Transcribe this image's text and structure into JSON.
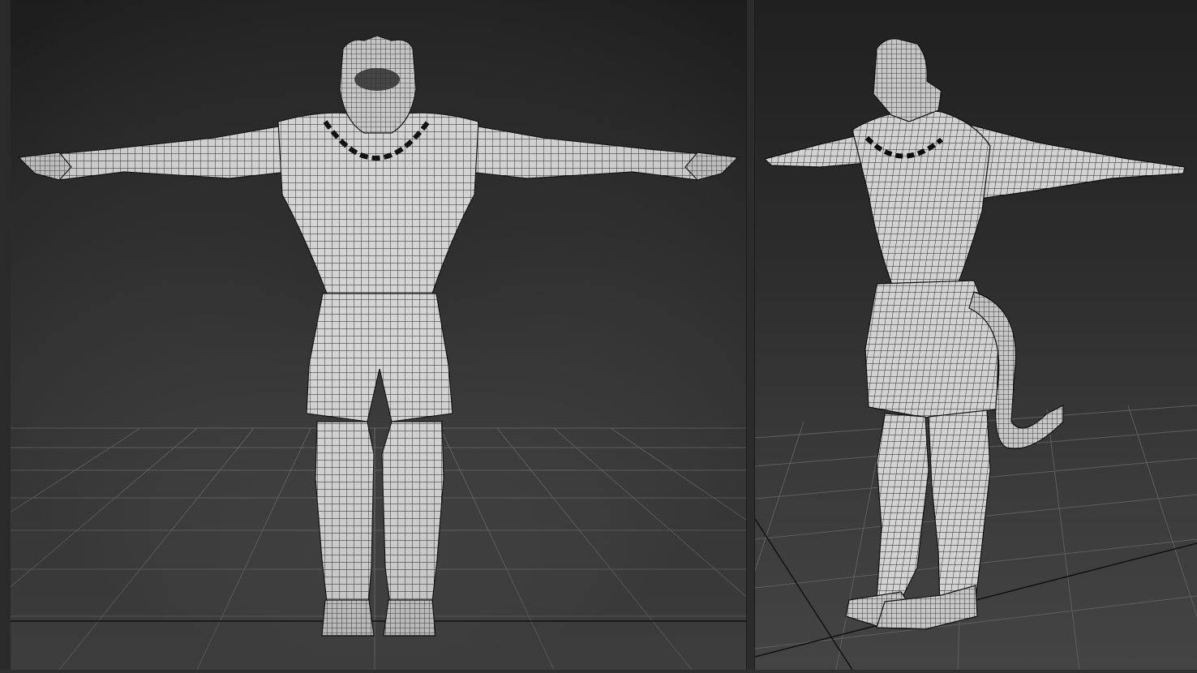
{
  "app": {
    "viewports": [
      {
        "id": "front",
        "view": "front-orthographic"
      },
      {
        "id": "perspective",
        "view": "three-quarter-perspective"
      }
    ],
    "shading": "wireframe-on-shaded",
    "colors": {
      "background_top": "#202020",
      "background_bottom": "#444444",
      "grid": "#5a5a5a",
      "mesh_fill": "#d8d8d8",
      "mesh_wire": "#1a1a1a"
    },
    "icons": {
      "model": "character-mesh-icon",
      "grid": "ground-grid-icon"
    }
  }
}
